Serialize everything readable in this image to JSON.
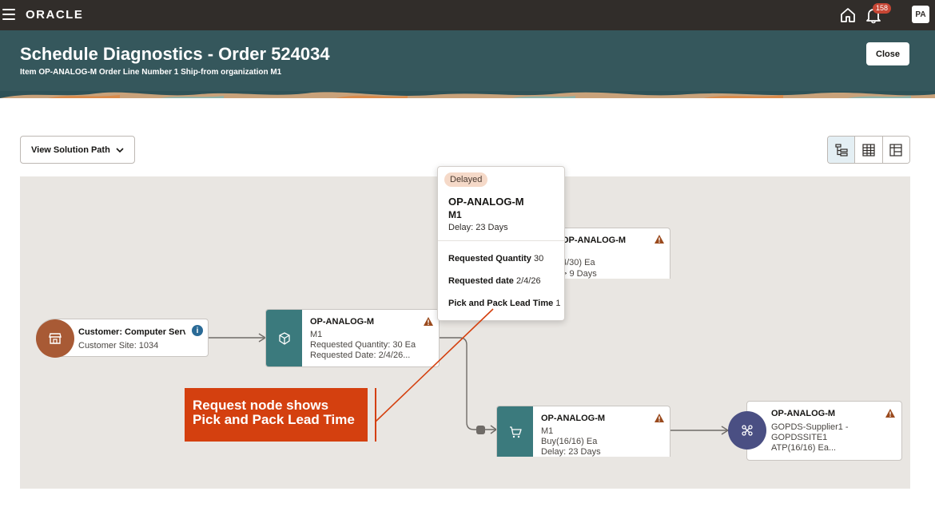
{
  "topbar": {
    "brand": "ORACLE",
    "notification_count": "158",
    "user_initials": "PA",
    "icons": [
      "hamburger-menu-icon",
      "home-icon",
      "bell-icon"
    ]
  },
  "header": {
    "title": "Schedule Diagnostics - Order 524034",
    "subtitle": "Item OP-ANALOG-M Order Line Number 1 Ship-from organization M1",
    "close_label": "Close"
  },
  "toolbar": {
    "view_solution_path": "View Solution Path",
    "view_modes": [
      "tree-view-icon",
      "table-view-icon",
      "grid-view-icon"
    ]
  },
  "nodes": {
    "customer": {
      "title": "Customer: Computer Serv",
      "site": "Customer Site: 1034"
    },
    "request": {
      "title": "OP-ANALOG-M",
      "org": "M1",
      "quantity": "Requested Quantity: 30 Ea",
      "date": "Requested Date: 2/4/26..."
    },
    "top": {
      "title": "OP-ANALOG-M",
      "line1": "4/30) Ea",
      "line2": "> 9 Days"
    },
    "buy": {
      "title": "OP-ANALOG-M",
      "org": "M1",
      "buy": "Buy(16/16) Ea",
      "delay": "Delay: 23 Days"
    },
    "supplier": {
      "title": "OP-ANALOG-M",
      "line1": "GOPDS-Supplier1 -",
      "line2": "GOPDSSITE1",
      "line3": "ATP(16/16) Ea..."
    }
  },
  "popup": {
    "status": "Delayed",
    "title": "OP-ANALOG-M",
    "org": "M1",
    "delay": "Delay: 23 Days",
    "rows": [
      {
        "label": "Requested Quantity",
        "value": "30"
      },
      {
        "label": "Requested date",
        "value": "2/4/26"
      },
      {
        "label": "Pick and Pack Lead Time",
        "value": "1"
      }
    ]
  },
  "callout": {
    "text": "Request node shows Pick and Pack Lead Time"
  },
  "colors": {
    "topbar": "#312d2a",
    "header": "#35575c",
    "canvas": "#e9e6e2",
    "callout": "#d4400f",
    "customer_icon": "#a85a35",
    "supplier_icon": "#4a4f83",
    "tile": "#3b7a7d"
  }
}
